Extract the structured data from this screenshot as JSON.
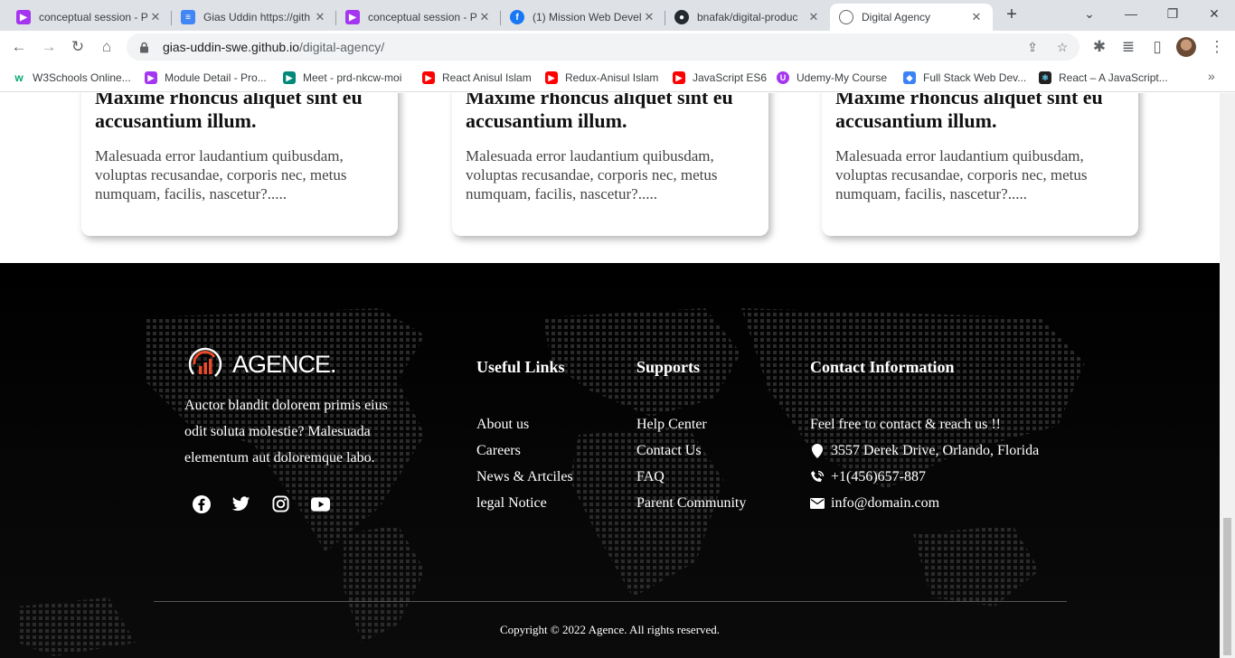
{
  "browser": {
    "tabs": [
      {
        "title": "conceptual session - P",
        "favicon": "play-icon",
        "color": "#a435f0"
      },
      {
        "title": "Gias Uddin https://gith",
        "favicon": "docs-icon",
        "color": "#4285f4"
      },
      {
        "title": "conceptual session - P",
        "favicon": "play-icon",
        "color": "#a435f0"
      },
      {
        "title": "(1) Mission Web Devel",
        "favicon": "facebook-icon",
        "color": "#1877f2"
      },
      {
        "title": "bnafak/digital-produc",
        "favicon": "github-icon",
        "color": "#24292f"
      },
      {
        "title": "Digital Agency",
        "favicon": "globe-icon",
        "color": "#5f6368"
      }
    ],
    "url_host": "gias-uddin-swe.github.io",
    "url_path": "/digital-agency/",
    "bookmarks": [
      {
        "label": "W3Schools Online...",
        "icon": "w3schools-icon",
        "color": "#04aa6d"
      },
      {
        "label": "Module Detail - Pro...",
        "icon": "play-icon",
        "color": "#a435f0"
      },
      {
        "label": "Meet - prd-nkcw-moi",
        "icon": "meet-icon",
        "color": "#00897b"
      },
      {
        "label": "React Anisul Islam",
        "icon": "youtube-icon",
        "color": "#ff0000"
      },
      {
        "label": "Redux-Anisul Islam",
        "icon": "youtube-icon",
        "color": "#ff0000"
      },
      {
        "label": "JavaScript ES6",
        "icon": "youtube-icon",
        "color": "#ff0000"
      },
      {
        "label": "Udemy-My Course",
        "icon": "udemy-icon",
        "color": "#a435f0"
      },
      {
        "label": "Full Stack Web Dev...",
        "icon": "course-icon",
        "color": "#3b82f6"
      },
      {
        "label": "React – A JavaScript...",
        "icon": "react-icon",
        "color": "#222"
      }
    ]
  },
  "cards": [
    {
      "title": "Maxime rhoncus aliquet sint eu accusantium illum.",
      "text": "Malesuada error laudantium quibusdam, voluptas recusandae, corporis nec, metus numquam, facilis, nascetur?....."
    },
    {
      "title": "Maxime rhoncus aliquet sint eu accusantium illum.",
      "text": "Malesuada error laudantium quibusdam, voluptas recusandae, corporis nec, metus numquam, facilis, nascetur?....."
    },
    {
      "title": "Maxime rhoncus aliquet sint eu accusantium illum.",
      "text": "Malesuada error laudantium quibusdam, voluptas recusandae, corporis nec, metus numquam, facilis, nascetur?....."
    }
  ],
  "footer": {
    "brand": "AGENCE.",
    "about": "Auctor blandit dolorem primis eius odit soluta molestie? Malesuada elementum aut doloremque labo.",
    "social": [
      "facebook-icon",
      "twitter-icon",
      "instagram-icon",
      "youtube-icon"
    ],
    "useful_links": {
      "heading": "Useful Links",
      "items": [
        "About us",
        "Careers",
        "News & Artciles",
        "legal Notice"
      ]
    },
    "supports": {
      "heading": "Supports",
      "items": [
        "Help Center",
        "Contact Us",
        "FAQ",
        "Parent Community"
      ]
    },
    "contact": {
      "heading": "Contact Information",
      "intro": "Feel free to contact & reach us !!",
      "address": "3557 Derek Drive, Orlando, Florida",
      "phone": "+1(456)657-887",
      "email": "info@domain.com"
    },
    "copyright": "Copyright © 2022 Agence. All rights reserved.",
    "accent_color": "#e84a2a"
  }
}
